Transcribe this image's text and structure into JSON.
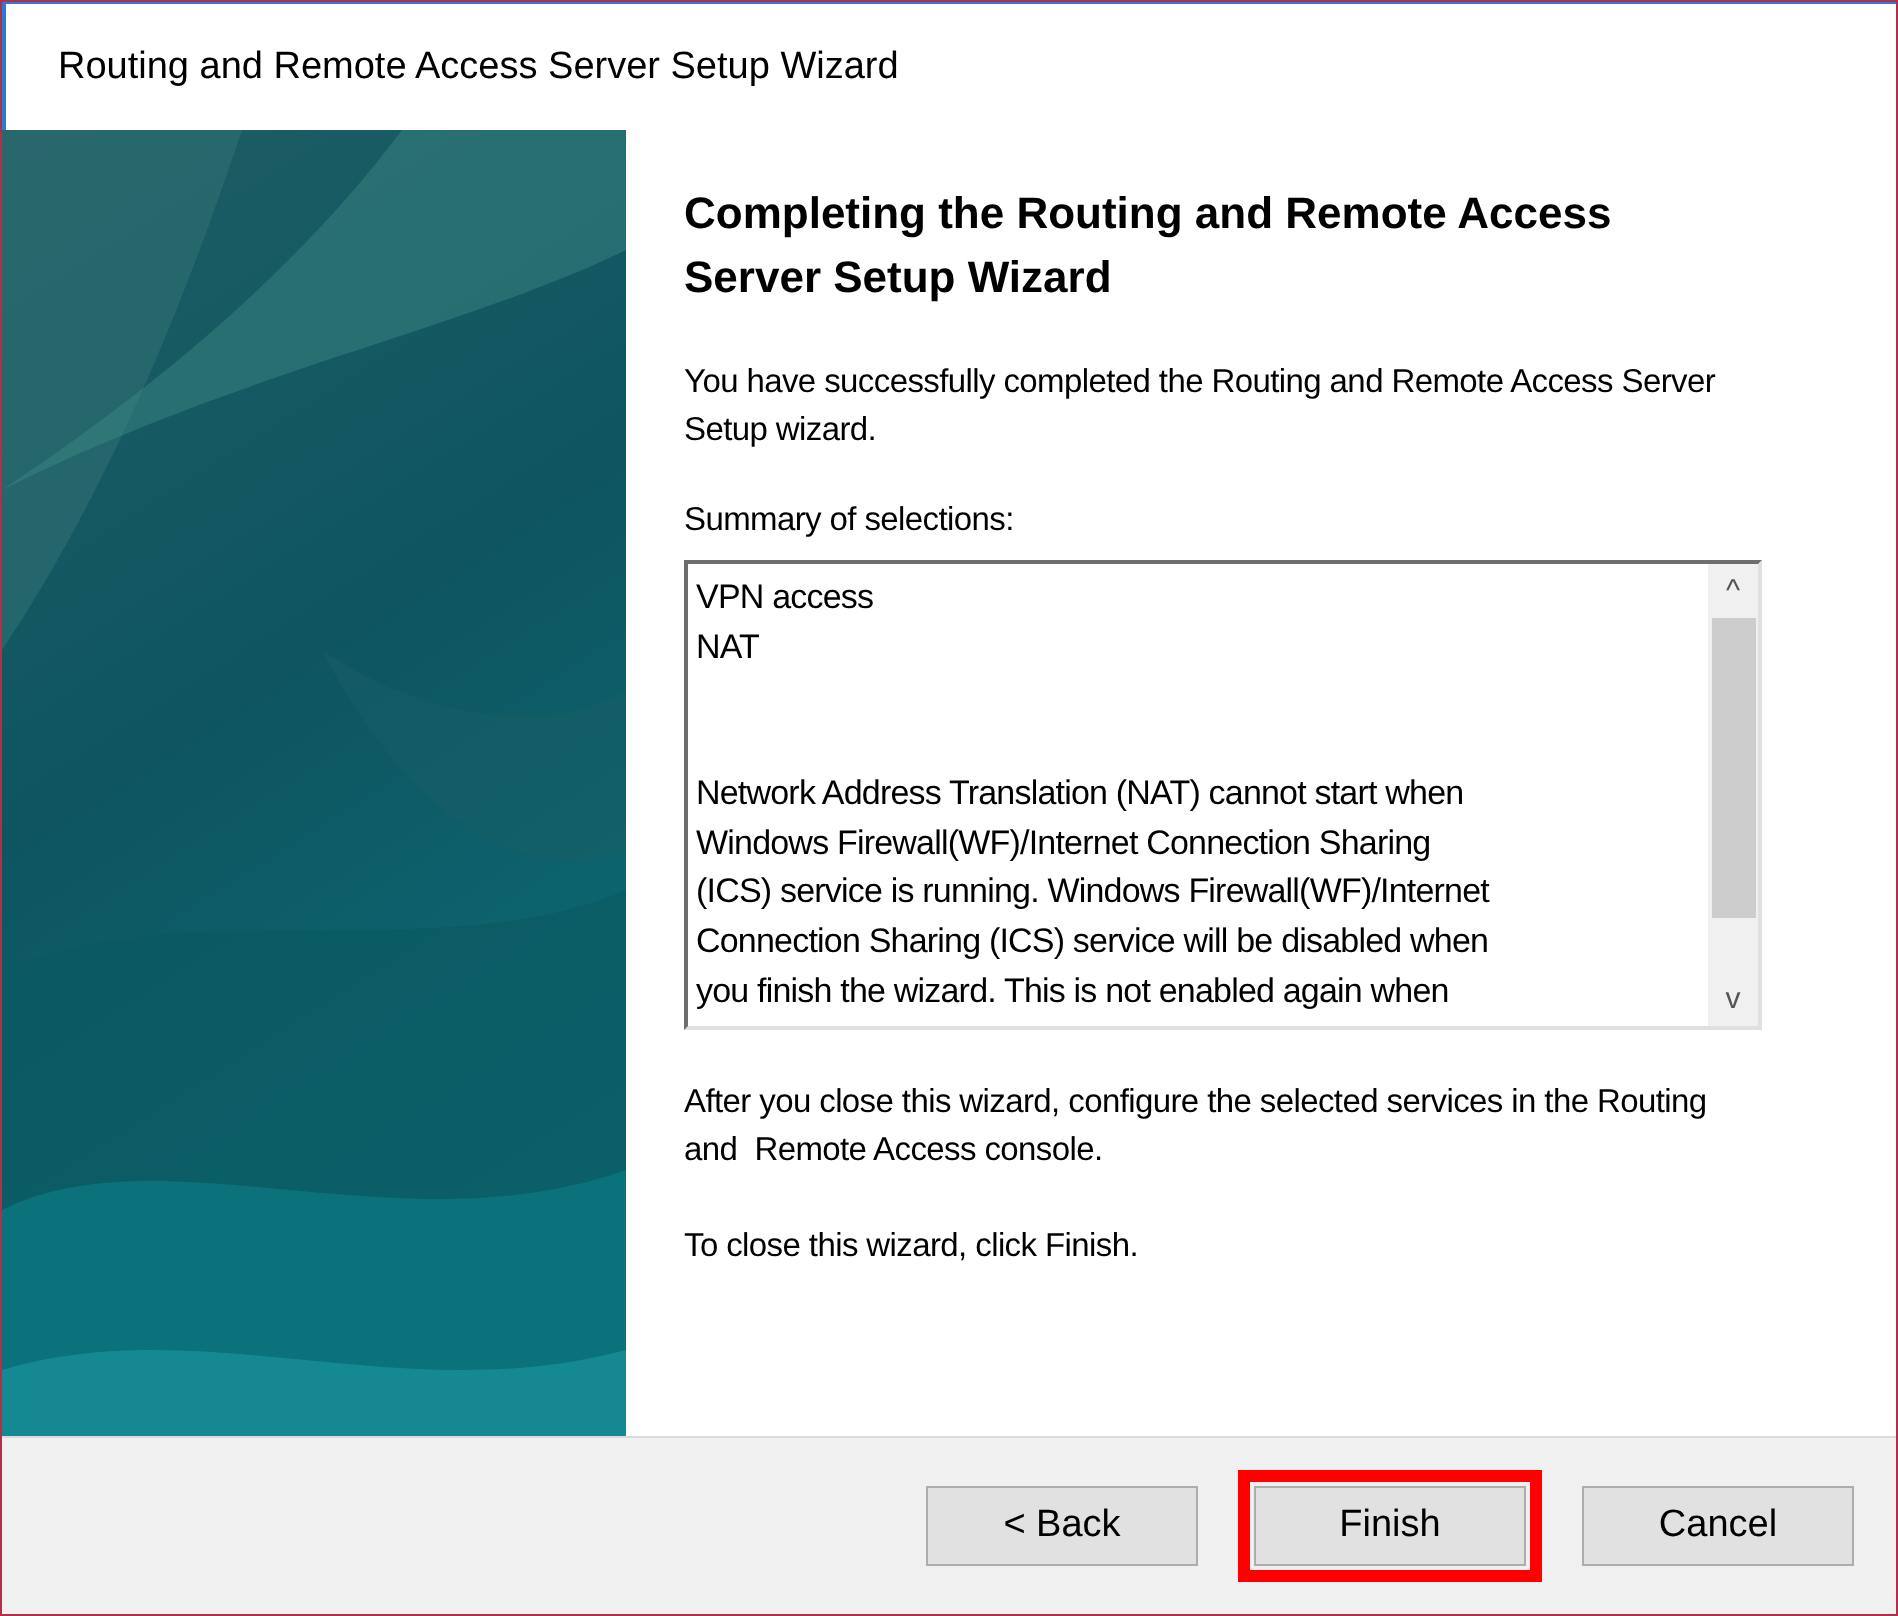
{
  "window": {
    "title": "Routing and Remote Access Server Setup Wizard"
  },
  "heading": "Completing the Routing and Remote Access Server Setup Wizard",
  "intro": "You have successfully completed the Routing and Remote Access Server Setup wizard.",
  "summary": {
    "label": "Summary of selections:",
    "items": [
      "VPN access",
      "NAT"
    ],
    "note_lines": [
      "Network Address Translation (NAT) cannot start when",
      "Windows Firewall(WF)/Internet Connection Sharing",
      "(ICS) service is running. Windows Firewall(WF)/Internet",
      "Connection Sharing (ICS) service will be disabled when",
      "you finish the wizard. This is not enabled again when"
    ],
    "scroll_up": "^",
    "scroll_down": "v"
  },
  "after": "After you close this wizard, configure the selected services in the Routing and  Remote Access console.",
  "close_hint": "To close this wizard, click Finish.",
  "buttons": [
    {
      "label": "< Back",
      "highlighted": false
    },
    {
      "label": "Finish",
      "highlighted": true
    },
    {
      "label": "Cancel",
      "highlighted": false
    }
  ]
}
